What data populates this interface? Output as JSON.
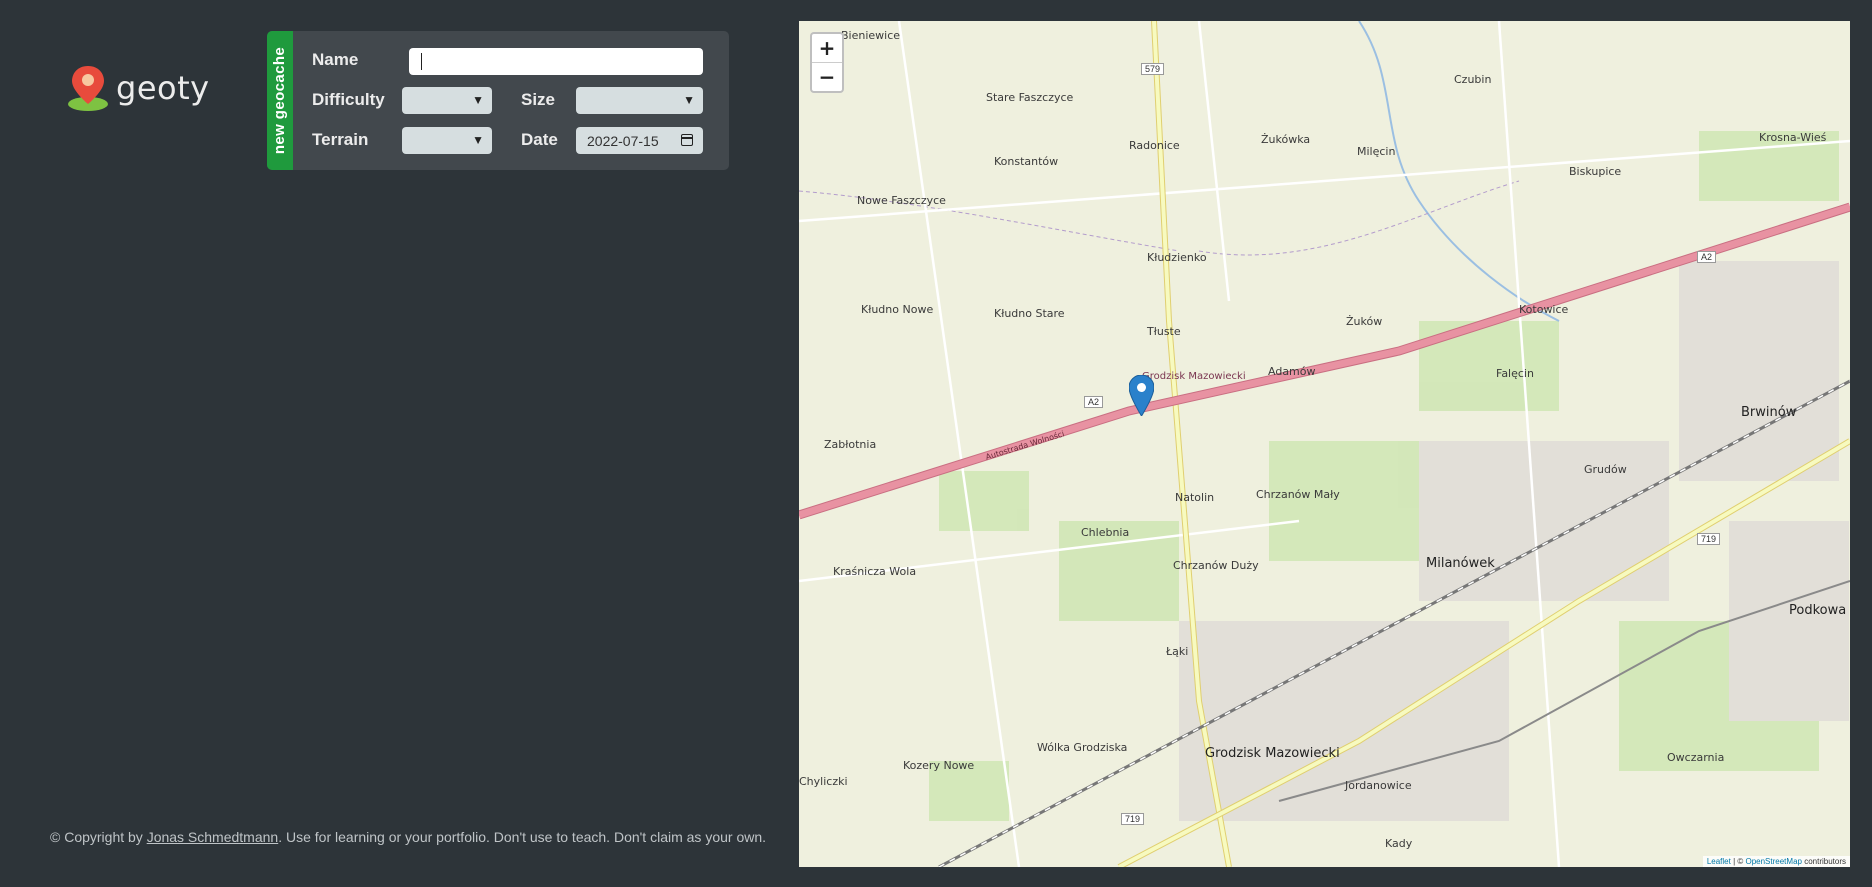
{
  "app": {
    "logo_text": "geoty"
  },
  "form": {
    "tab_label": "new geocache",
    "name_label": "Name",
    "name_value": "",
    "difficulty_label": "Difficulty",
    "difficulty_value": "",
    "size_label": "Size",
    "size_value": "",
    "terrain_label": "Terrain",
    "terrain_value": "",
    "date_label": "Date",
    "date_value": "2022-07-15"
  },
  "footer": {
    "prefix": "© Copyright by ",
    "author": "Jonas Schmedtmann",
    "suffix": ". Use for learning or your portfolio. Don't use to teach. Don't claim as your own."
  },
  "map": {
    "zoom_in": "+",
    "zoom_out": "−",
    "attribution_leaflet": "Leaflet",
    "attribution_osm_prefix": " | © ",
    "attribution_osm": "OpenStreetMap",
    "attribution_suffix": " contributors",
    "labels": [
      "Bieniewice",
      "Stare Faszczyce",
      "Radonice",
      "Żukówka",
      "Milęcin",
      "Czubin",
      "Krosna-Wieś",
      "Konstantów",
      "Biskupice",
      "Nowe Faszczyce",
      "Kłudzienko",
      "Kłudno Nowe",
      "Kłudno Stare",
      "Tłuste",
      "Żuków",
      "Kotowice",
      "Adamów",
      "Falęcin",
      "Brwinów",
      "Zabłotnia",
      "Grudów",
      "Natolin",
      "Chrzanów Mały",
      "Chlebnia",
      "Chrzanów Duży",
      "Milanówek",
      "Kraśnicza Wola",
      "Podkowa",
      "Łąki",
      "Wólka Grodziska",
      "Grodzisk Mazowiecki",
      "Kozery Nowe",
      "Owczarnia",
      "Jordanowice",
      "Kady",
      "Chyliczki",
      "Grodzisk Mazowiecki",
      "Autostrada Wolności"
    ],
    "roads": [
      "579",
      "A2",
      "A2",
      "719",
      "719"
    ],
    "colors": {
      "motorway": "#e892a2",
      "primary": "#f7fabf",
      "rail": "#777777",
      "marker": "#2a81cb"
    }
  }
}
